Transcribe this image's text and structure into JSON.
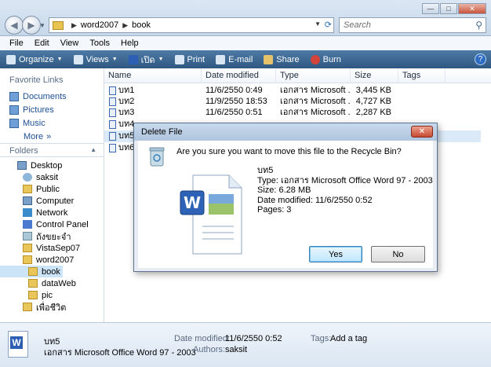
{
  "window": {
    "address": [
      "word2007",
      "book"
    ],
    "search_placeholder": "Search"
  },
  "menu": [
    "File",
    "Edit",
    "View",
    "Tools",
    "Help"
  ],
  "toolbar": [
    {
      "label": "Organize",
      "icon": "organize-icon",
      "dropdown": true
    },
    {
      "label": "Views",
      "icon": "views-icon",
      "dropdown": true
    },
    {
      "label": "เปิด",
      "icon": "word-icon",
      "dropdown": true
    },
    {
      "label": "Print",
      "icon": "print-icon",
      "dropdown": false
    },
    {
      "label": "E-mail",
      "icon": "email-icon",
      "dropdown": false
    },
    {
      "label": "Share",
      "icon": "share-icon",
      "dropdown": false
    },
    {
      "label": "Burn",
      "icon": "burn-icon",
      "dropdown": false
    }
  ],
  "nav": {
    "favorites_header": "Favorite Links",
    "favorites": [
      "Documents",
      "Pictures",
      "Music"
    ],
    "more": "More",
    "folders_header": "Folders",
    "tree": [
      {
        "label": "Desktop",
        "icon": "pc"
      },
      {
        "label": "saksit",
        "icon": "user"
      },
      {
        "label": "Public",
        "icon": "folder"
      },
      {
        "label": "Computer",
        "icon": "pc"
      },
      {
        "label": "Network",
        "icon": "net"
      },
      {
        "label": "Control Panel",
        "icon": "cp"
      },
      {
        "label": "ถังขยะจำ",
        "icon": "bin"
      },
      {
        "label": "VistaSep07",
        "icon": "folder"
      },
      {
        "label": "word2007",
        "icon": "folder"
      },
      {
        "label": "book",
        "icon": "folder"
      },
      {
        "label": "dataWeb",
        "icon": "folder"
      },
      {
        "label": "pic",
        "icon": "folder"
      },
      {
        "label": "เพื่อชีวิต",
        "icon": "folder"
      }
    ]
  },
  "columns": [
    "Name",
    "Date modified",
    "Type",
    "Size",
    "Tags"
  ],
  "files": [
    {
      "name": "บท1",
      "date": "11/6/2550 0:49",
      "type": "เอกสาร Microsoft ...",
      "size": "3,445 KB"
    },
    {
      "name": "บท2",
      "date": "11/9/2550 18:53",
      "type": "เอกสาร Microsoft ...",
      "size": "4,727 KB"
    },
    {
      "name": "บท3",
      "date": "11/6/2550 0:51",
      "type": "เอกสาร Microsoft ...",
      "size": "2,287 KB"
    },
    {
      "name": "บท4",
      "date": "",
      "type": "",
      "size": ""
    },
    {
      "name": "บท5",
      "date": "",
      "type": "",
      "size": ""
    },
    {
      "name": "บท6",
      "date": "",
      "type": "",
      "size": ""
    }
  ],
  "details": {
    "name": "บท5",
    "type": "เอกสาร Microsoft Office Word 97 - 2003",
    "date_label": "Date modified:",
    "date_value": "11/6/2550 0:52",
    "authors_label": "Authors:",
    "authors_value": "saksit",
    "tags_label": "Tags:",
    "tags_value": "Add a tag"
  },
  "dialog": {
    "title": "Delete File",
    "question": "Are you sure you want to move this file to the Recycle Bin?",
    "file_name": "บท5",
    "file_type": "Type: เอกสาร Microsoft Office Word 97 - 2003",
    "file_size": "Size: 6.28 MB",
    "file_date": "Date modified: 11/6/2550 0:52",
    "file_pages": "Pages: 3",
    "yes": "Yes",
    "no": "No"
  }
}
